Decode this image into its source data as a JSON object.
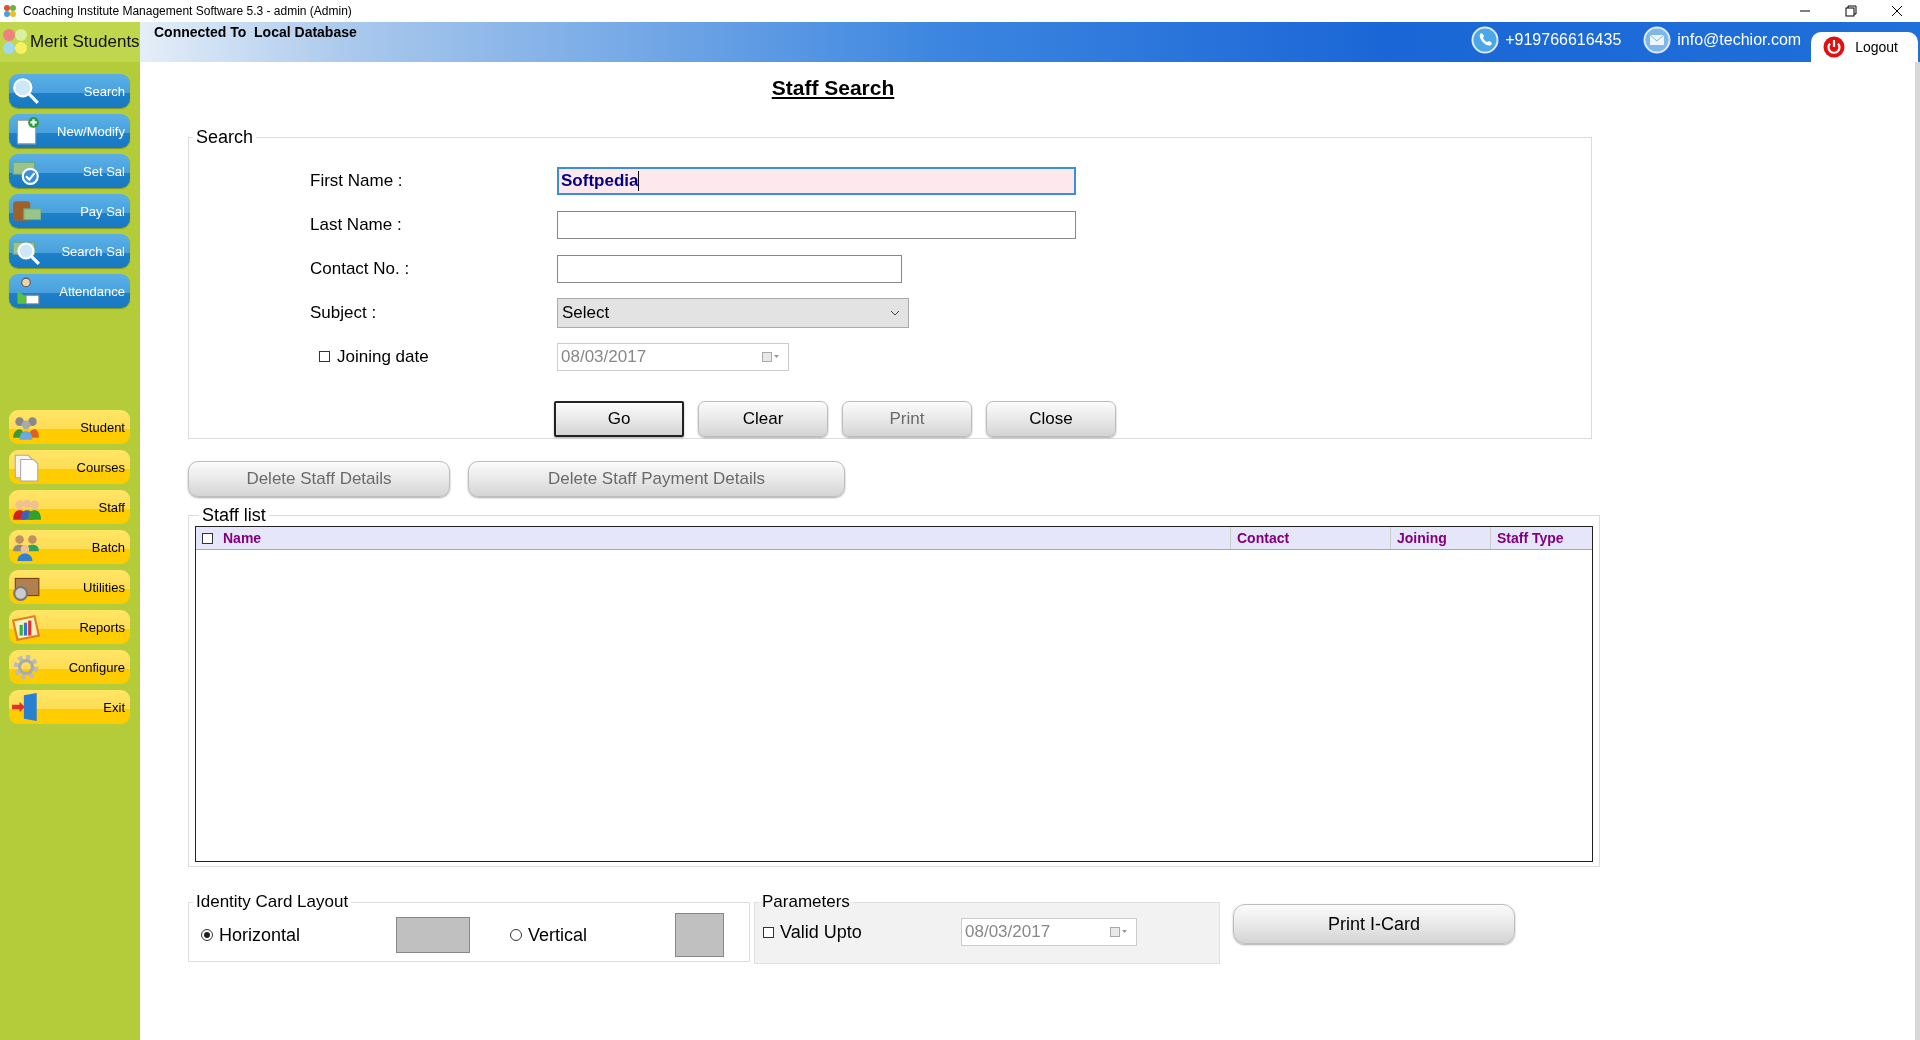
{
  "window": {
    "title": "Coaching Institute Management Software 5.3  -  admin (Admin)"
  },
  "sidebar": {
    "logo": "Merit Students",
    "top_items": [
      {
        "label": "Search"
      },
      {
        "label": "New/Modify"
      },
      {
        "label": "Set Sal"
      },
      {
        "label": "Pay Sal"
      },
      {
        "label": "Search Sal"
      },
      {
        "label": "Attendance"
      }
    ],
    "main_items": [
      {
        "label": "Student"
      },
      {
        "label": "Courses"
      },
      {
        "label": "Staff"
      },
      {
        "label": "Batch"
      },
      {
        "label": "Utilities"
      },
      {
        "label": "Reports"
      },
      {
        "label": "Configure"
      },
      {
        "label": "Exit"
      }
    ]
  },
  "header": {
    "connection": "Connected To  Local Database",
    "phone": "+919766616435",
    "email": "info@techior.com",
    "logout": "Logout"
  },
  "page_title": "Staff Search",
  "search": {
    "legend": "Search",
    "fields": [
      {
        "kind": "text",
        "label": "First Name :",
        "value": "Softpedia",
        "focused": true
      },
      {
        "kind": "text",
        "label": "Last Name :",
        "focused": false
      },
      {
        "kind": "short_text",
        "label": "Contact No. :",
        "focused": false
      },
      {
        "kind": "select",
        "label": "Subject :",
        "value": "Select",
        "focused": false
      },
      {
        "kind": "checkbox_date",
        "label": "Joining date",
        "checked": false,
        "value": "08/03/2017"
      }
    ],
    "buttons": [
      {
        "label": "Go",
        "focused": true,
        "disabled": false
      },
      {
        "label": "Clear",
        "focused": false,
        "disabled": false
      },
      {
        "label": "Print",
        "focused": false,
        "disabled": true
      },
      {
        "label": "Close",
        "focused": false,
        "disabled": false
      }
    ]
  },
  "actions": [
    {
      "label": "Delete Staff Details",
      "disabled": true
    },
    {
      "label": "Delete Staff Payment Details",
      "disabled": true
    }
  ],
  "staff_list": {
    "legend": "Staff list",
    "select_all": false,
    "columns": [
      "Name",
      "Contact",
      "Joining",
      "Staff Type"
    ]
  },
  "id_card": {
    "legend": "Identity Card Layout",
    "options": [
      {
        "label": "Horizontal",
        "selected": true
      },
      {
        "label": "Vertical",
        "selected": false
      }
    ]
  },
  "parameters": {
    "legend": "Parameters",
    "valid_upto": {
      "label": "Valid Upto",
      "checked": false,
      "value": "08/03/2017"
    }
  },
  "print_card": {
    "label": "Print I-Card"
  }
}
